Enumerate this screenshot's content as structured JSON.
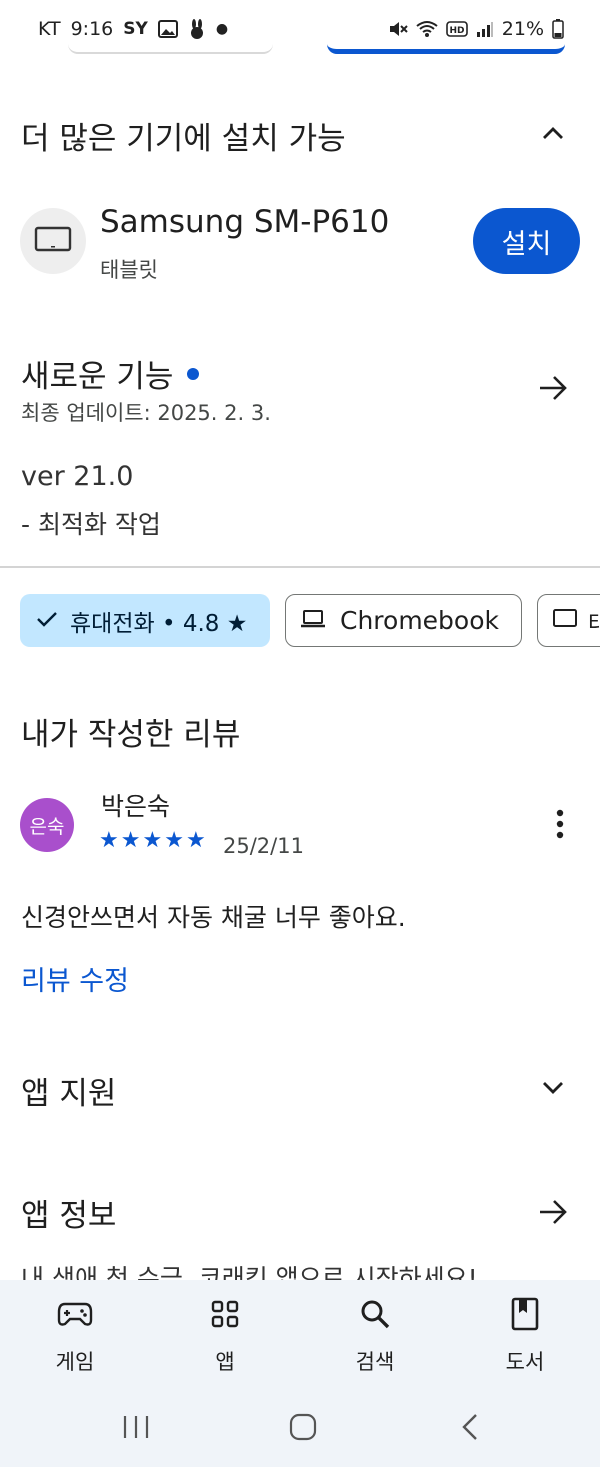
{
  "status_bar": {
    "carrier": "KT",
    "time": "9:16",
    "battery": "21%"
  },
  "more_devices": {
    "title": "더 많은 기기에 설치 가능",
    "device_name": "Samsung SM-P610",
    "device_type": "태블릿",
    "install_label": "설치"
  },
  "whats_new": {
    "title": "새로운 기능",
    "updated": "최종 업데이트: 2025. 2. 3.",
    "version": "ver 21.0",
    "note": "- 최적화 작업"
  },
  "chips": {
    "phone": "휴대전화 • 4.8 ★",
    "chromebook": "Chromebook",
    "tablet": "태"
  },
  "my_review": {
    "heading": "내가 작성한 리뷰",
    "avatar_text": "은숙",
    "name": "박은숙",
    "rating": 5,
    "date": "25/2/11",
    "text": "신경안쓰면서 자동 채굴 너무 좋아요.",
    "edit_label": "리뷰 수정"
  },
  "app_support": {
    "title": "앱 지원"
  },
  "app_info": {
    "title": "앱 정보",
    "peek_text": "내 생애 첫 수금, 코래킹 앱으로 시작하세요!"
  },
  "bottom_nav": {
    "items": [
      {
        "label": "게임",
        "icon": "gamepad-icon"
      },
      {
        "label": "앱",
        "icon": "apps-grid-icon"
      },
      {
        "label": "검색",
        "icon": "search-icon"
      },
      {
        "label": "도서",
        "icon": "book-icon"
      }
    ]
  },
  "colors": {
    "accent": "#0b57d0",
    "chip_selected": "#c2e7ff",
    "avatar": "#a94fcc",
    "nav_bg": "#f0f4f9"
  }
}
